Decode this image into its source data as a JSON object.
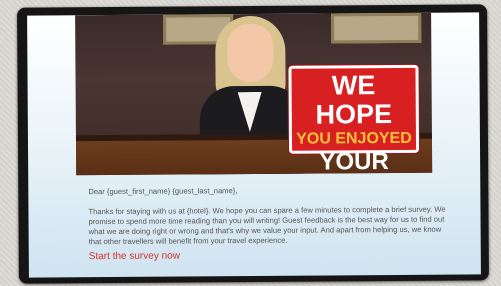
{
  "hero": {
    "sign_line1": "WE HOPE",
    "sign_line2": "YOU ENJOYED",
    "sign_line3": "YOUR STAY",
    "sign_color": "#d81f22",
    "accent_color": "#f7c23a"
  },
  "email": {
    "greeting": "Dear {guest_first_name} {guest_last_name},",
    "body": "Thanks for staying with us at {hotel}. We hope you can spare a few minutes to complete a brief survey. We promise to spend more time reading than you will writing! Guest feedback is the best way for us to find out what we are doing right or wrong and that's why we value your input. And apart from helping us, we know that other travellers will benefit from your travel experience.",
    "cta_label": "Start the survey now",
    "cta_color": "#d6322c"
  }
}
